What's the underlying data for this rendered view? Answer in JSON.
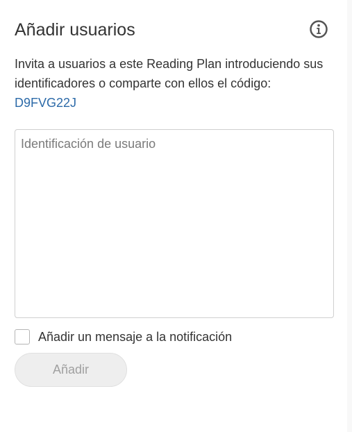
{
  "dialog": {
    "title": "Añadir usuarios",
    "info_icon": "info-circle-icon",
    "description": "Invita a usuarios a este Reading Plan introduciendo sus identificadores o comparte con ellos el código:",
    "code": "D9FVG22J"
  },
  "userid_input": {
    "placeholder": "Identificación de usuario",
    "value": ""
  },
  "message_option": {
    "label": "Añadir un mensaje a la notificación",
    "checked": false
  },
  "add_button": {
    "label": "Añadir",
    "enabled": false
  },
  "colors": {
    "link": "#2c6aa8",
    "text": "#333333",
    "disabled_button_bg": "#eeeeee",
    "disabled_button_text": "#a0a0a0"
  }
}
